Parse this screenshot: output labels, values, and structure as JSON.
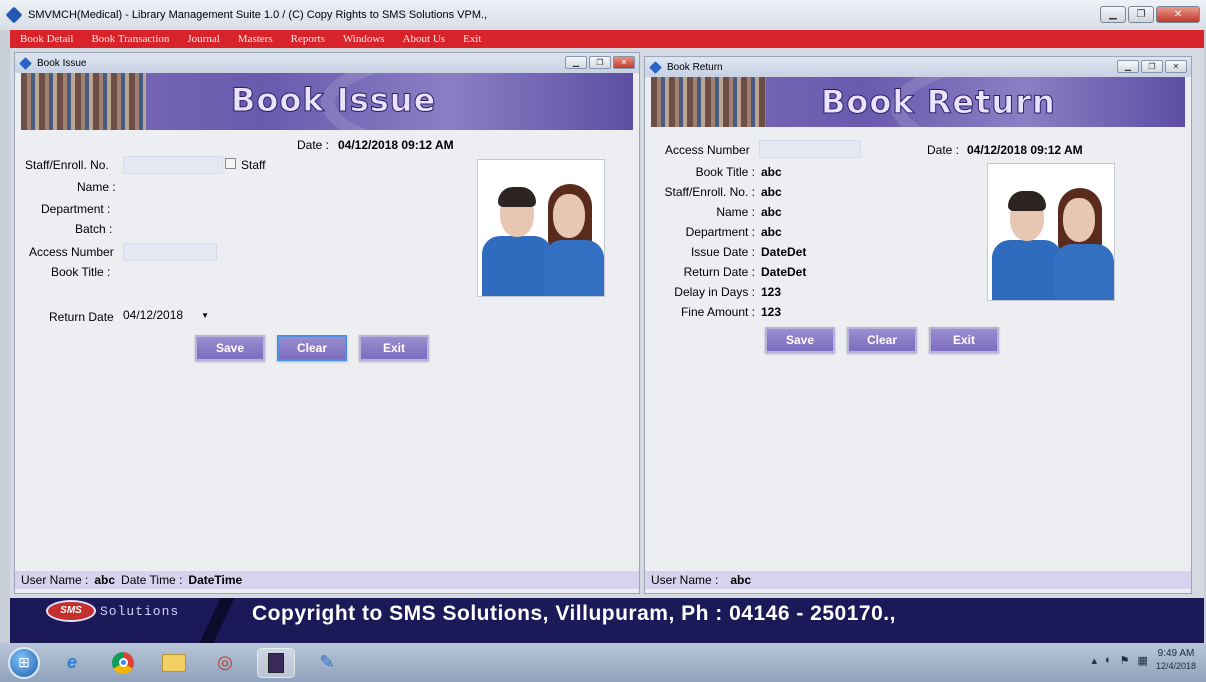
{
  "app": {
    "title": "SMVMCH(Medical) - Library Management Suite 1.0  / (C) Copy Rights to SMS Solutions VPM.,"
  },
  "menu": [
    "Book Detail",
    "Book Transaction",
    "Journal",
    "Masters",
    "Reports",
    "Windows",
    "About Us",
    "Exit"
  ],
  "book_issue": {
    "window_title": "Book Issue",
    "banner_title": "Book Issue",
    "date_label": "Date :",
    "date_value": "04/12/2018 09:12 AM",
    "staff_label": "Staff/Enroll. No.",
    "staff_checkbox_label": "Staff",
    "name_label": "Name :",
    "department_label": "Department :",
    "batch_label": "Batch :",
    "access_label": "Access Number",
    "book_title_label": "Book Title :",
    "return_date_label": "Return Date",
    "return_date_value": "04/12/2018",
    "save": "Save",
    "clear": "Clear",
    "exit": "Exit",
    "status_user_label": "User Name :",
    "status_user_value": "abc",
    "status_dt_label": "Date Time :",
    "status_dt_value": "DateTime"
  },
  "book_return": {
    "window_title": "Book Return",
    "banner_title": "Book Return",
    "access_label": "Access Number",
    "date_label": "Date :",
    "date_value": "04/12/2018 09:12 AM",
    "rows": [
      {
        "label": "Book Title :",
        "value": "abc"
      },
      {
        "label": "Staff/Enroll. No. :",
        "value": "abc"
      },
      {
        "label": "Name :",
        "value": "abc"
      },
      {
        "label": "Department :",
        "value": "abc"
      },
      {
        "label": "Issue Date :",
        "value": "DateDet"
      },
      {
        "label": "Return Date :",
        "value": "DateDet"
      },
      {
        "label": "Delay in Days :",
        "value": "123"
      },
      {
        "label": "Fine Amount :",
        "value": "123"
      }
    ],
    "save": "Save",
    "clear": "Clear",
    "exit": "Exit",
    "status_user_label": "User Name :",
    "status_user_value": "abc"
  },
  "footer": {
    "logo_text": "SMS",
    "logo_suffix": "Solutions",
    "copyright": "Copyright to SMS Solutions, Villupuram, Ph : 04146 - 250170.,"
  },
  "taskbar": {
    "time": "9:49 AM",
    "date": "12/4/2018"
  }
}
